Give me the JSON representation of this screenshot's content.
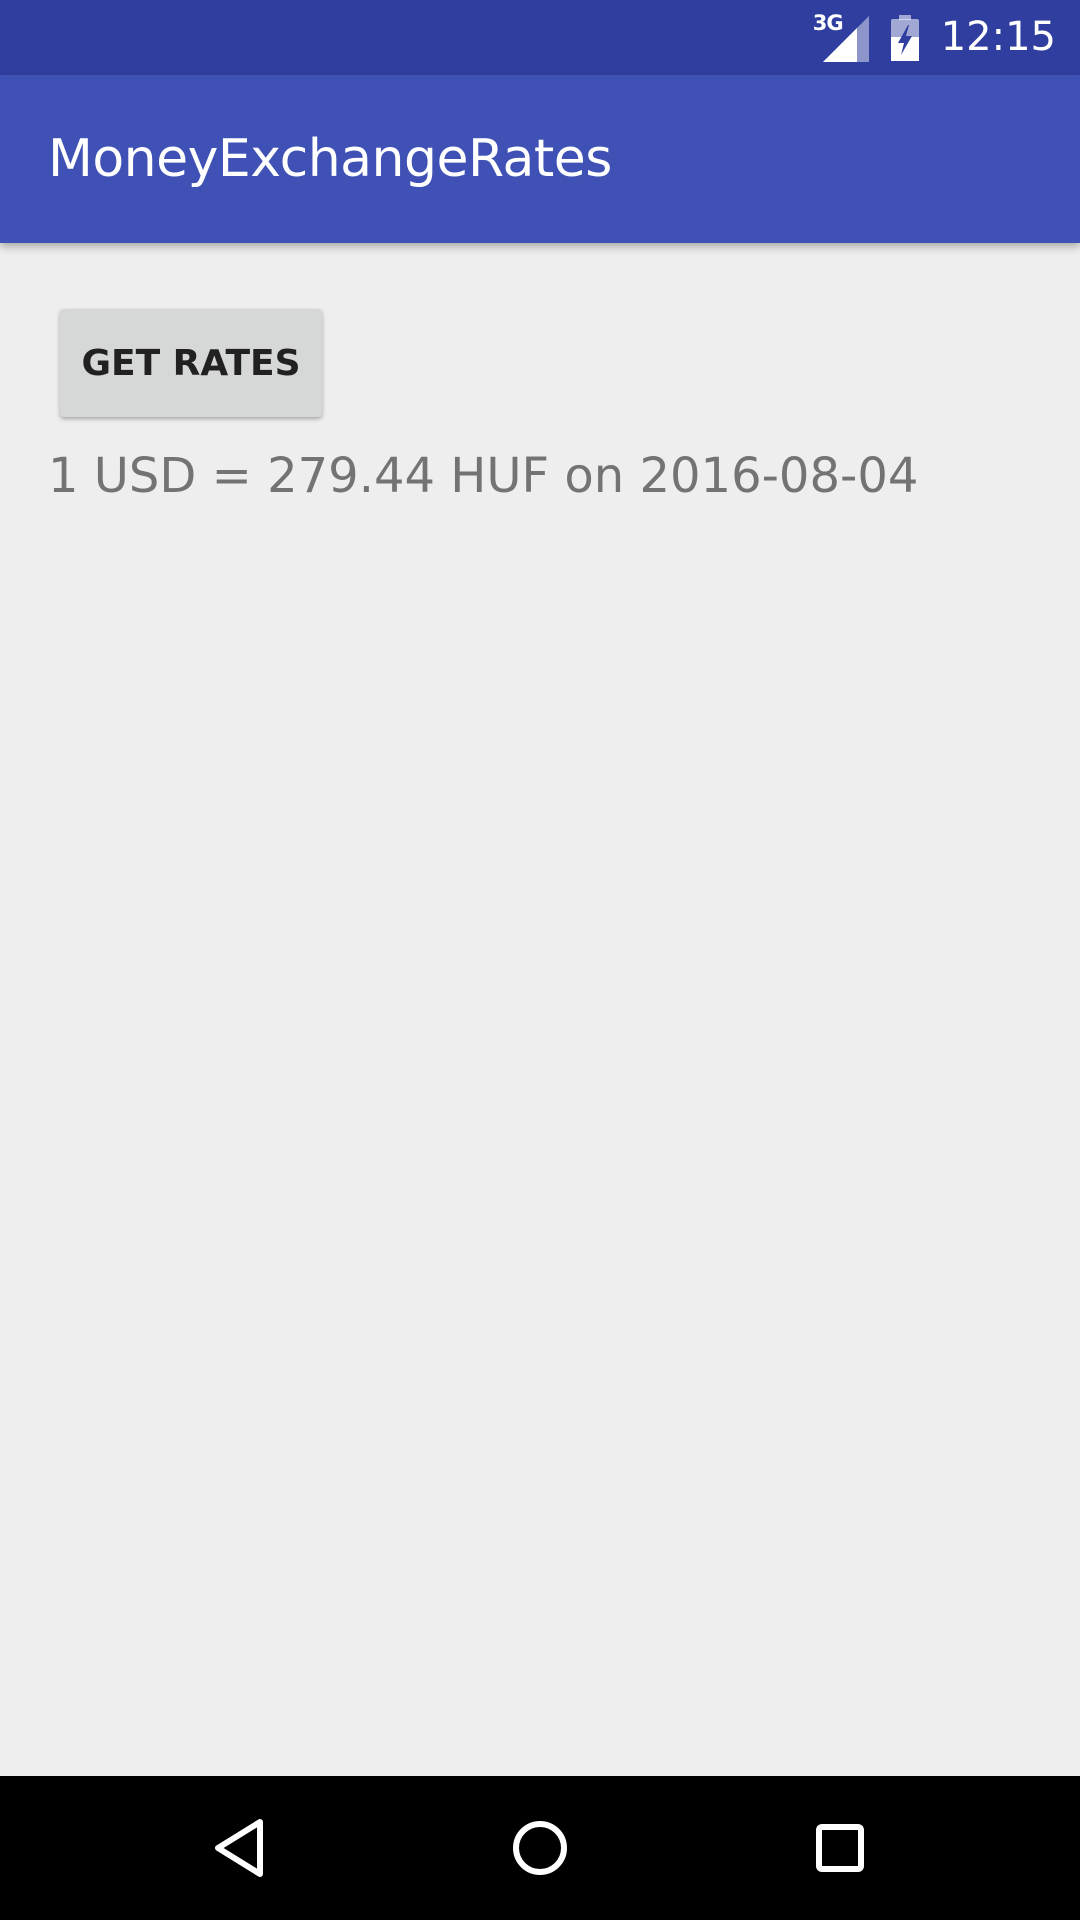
{
  "status_bar": {
    "network_type": "3G",
    "time": "12:15",
    "icons": [
      "signal-icon",
      "battery-charging-icon"
    ],
    "color": "#303f9f"
  },
  "app_bar": {
    "title": "MoneyExchangeRates",
    "color": "#3f51b5"
  },
  "main": {
    "get_rates_label": "GET RATES",
    "rate_text": "1 USD = 279.44 HUF on 2016-08-04"
  },
  "nav_bar": {
    "icons": [
      "back-icon",
      "home-icon",
      "recents-icon"
    ]
  }
}
